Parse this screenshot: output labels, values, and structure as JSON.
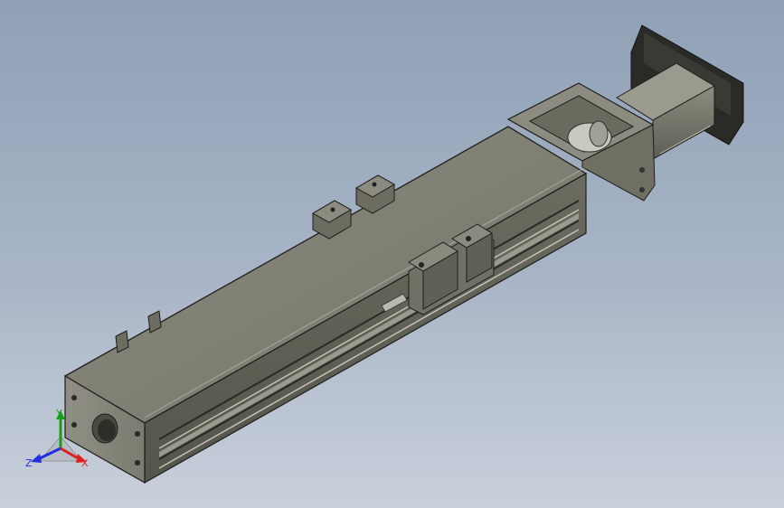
{
  "view": {
    "background_top": "#8fa0b6",
    "background_bottom": "#c9d0db",
    "body_color": "#7d7d70",
    "edge_color": "#1e1e1a"
  },
  "triad": {
    "x_label": "X",
    "y_label": "Y",
    "z_label": "Z",
    "x_color": "#e02020",
    "y_color": "#18a018",
    "z_color": "#2030e0"
  }
}
